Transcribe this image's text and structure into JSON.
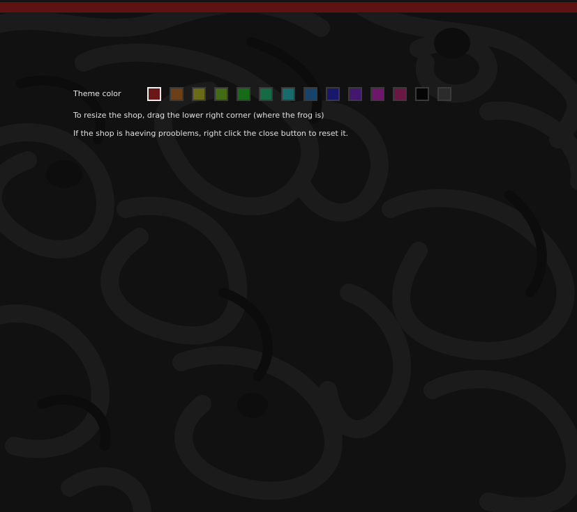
{
  "window": {
    "accent_color": "#5e1212"
  },
  "settings": {
    "theme_label": "Theme color",
    "selected_index": 0,
    "swatches": [
      {
        "name": "red",
        "color": "#6b1717"
      },
      {
        "name": "orange",
        "color": "#6b3f17"
      },
      {
        "name": "olive",
        "color": "#6b6b17"
      },
      {
        "name": "green-yellow",
        "color": "#436b17"
      },
      {
        "name": "green",
        "color": "#176b17"
      },
      {
        "name": "sea-green",
        "color": "#176b43"
      },
      {
        "name": "teal",
        "color": "#176b6b"
      },
      {
        "name": "steel-blue",
        "color": "#17436b"
      },
      {
        "name": "blue",
        "color": "#17176b"
      },
      {
        "name": "purple",
        "color": "#43176b"
      },
      {
        "name": "magenta",
        "color": "#6b176b"
      },
      {
        "name": "crimson",
        "color": "#6b1743"
      },
      {
        "name": "black",
        "color": "#050505"
      },
      {
        "name": "dark-gray",
        "color": "#2b2b2b"
      }
    ],
    "resize_hint": "To resize the shop, drag the lower right corner (where the frog is)",
    "reset_hint": "If the shop is haeving prooblems, right click the close button to reset it."
  }
}
